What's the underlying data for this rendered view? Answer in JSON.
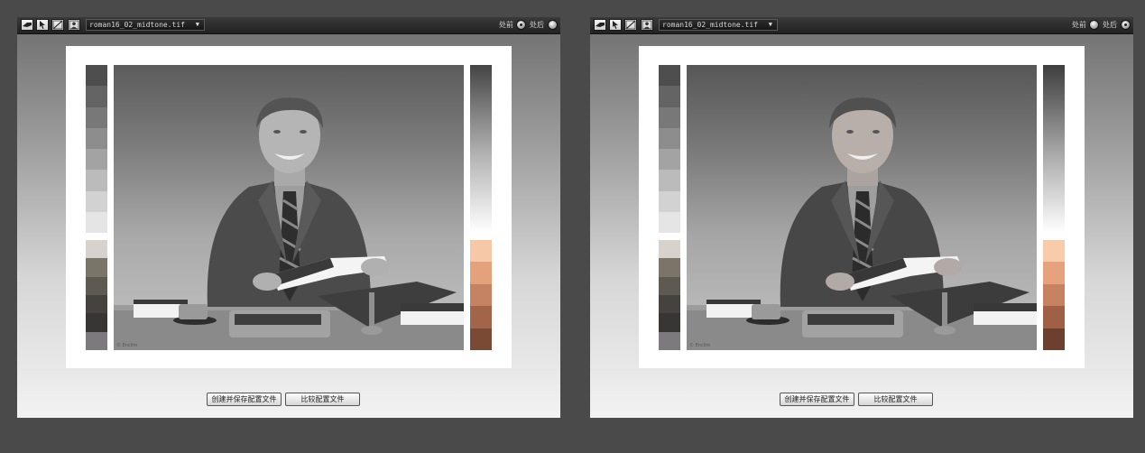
{
  "panels": [
    {
      "id": "left",
      "file_name": "roman16_02_midtone.tif",
      "view_before_label": "处前",
      "view_after_label": "处后",
      "selected_view": "before",
      "photo_credit": "© Enclim",
      "create_save_profile_label": "创建并保存配置文件",
      "compare_profile_label": "比较配置文件",
      "gray_strip": [
        "#4e4e4e",
        "#646464",
        "#787878",
        "#8d8d8d",
        "#a3a3a3",
        "#bbbbbb",
        "#d2d2d2",
        "#e5e5e5"
      ],
      "tone_strip": [
        "#d7d2cd",
        "#7b7468",
        "#5e5a52",
        "#46433e",
        "#383634",
        "#7c7a7c"
      ],
      "skin_strip": [
        "#f6c8a8",
        "#e3a17c",
        "#c68363",
        "#a26549",
        "#7a4a34"
      ]
    },
    {
      "id": "right",
      "file_name": "roman16_02_midtone.tif",
      "view_before_label": "处前",
      "view_after_label": "处后",
      "selected_view": "after",
      "photo_credit": "© Enclim",
      "create_save_profile_label": "创建并保存配置文件",
      "compare_profile_label": "比较配置文件",
      "gray_strip": [
        "#4e4e4e",
        "#646464",
        "#787878",
        "#8d8d8d",
        "#a3a3a3",
        "#bbbbbb",
        "#d2d2d2",
        "#e5e5e5"
      ],
      "tone_strip": [
        "#d7d2cd",
        "#7b7468",
        "#5e5a52",
        "#46433e",
        "#383634",
        "#7c7a7c"
      ],
      "skin_strip": [
        "#f8cbaa",
        "#e6a27c",
        "#c78262",
        "#9f6046",
        "#6c3f2e"
      ]
    }
  ],
  "icons": [
    "hand-icon",
    "pointer-icon",
    "curve-icon",
    "portrait-icon",
    "chevron-down-icon"
  ]
}
